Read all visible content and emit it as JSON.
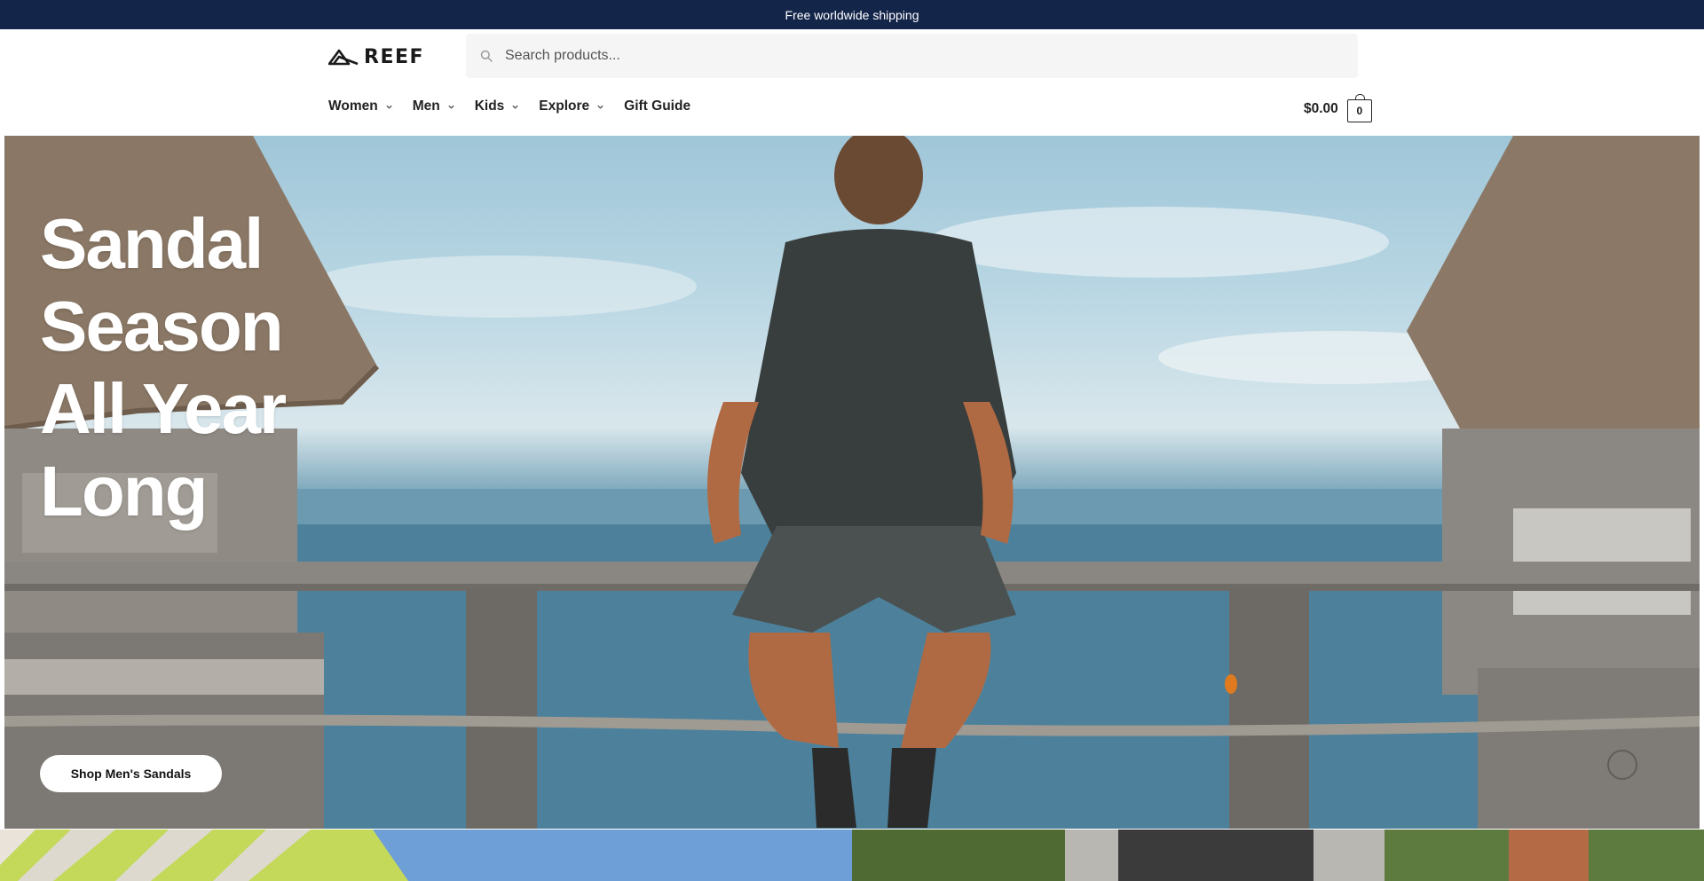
{
  "announcement": {
    "text": "Free worldwide shipping"
  },
  "header": {
    "logo_text": "REEF",
    "search": {
      "placeholder": "Search products...",
      "value": ""
    },
    "nav": [
      {
        "label": "Women",
        "has_dropdown": true
      },
      {
        "label": "Men",
        "has_dropdown": true
      },
      {
        "label": "Kids",
        "has_dropdown": true
      },
      {
        "label": "Explore",
        "has_dropdown": true
      },
      {
        "label": "Gift Guide",
        "has_dropdown": false
      }
    ],
    "cart": {
      "total": "$0.00",
      "count": "0"
    }
  },
  "hero": {
    "title_lines": [
      "Sandal",
      "Season",
      "All Year",
      "Long"
    ],
    "cta_label": "Shop Men's Sandals"
  },
  "colors": {
    "announcement_bg": "#14254a",
    "search_bg": "#f5f5f5",
    "text": "#1a1a1a"
  },
  "icons": {
    "search": "search-icon",
    "dropdown": "chevron-down-icon",
    "cart": "shopping-bag-icon",
    "logo": "reef-wave-logo-icon"
  }
}
